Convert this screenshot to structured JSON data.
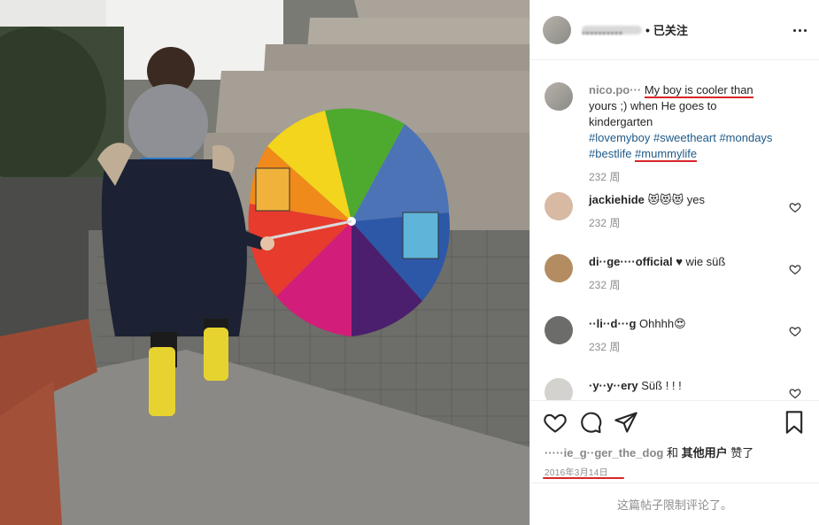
{
  "post": {
    "author_handle": "··········",
    "separator": "•",
    "follow_status": "已关注"
  },
  "caption": {
    "handle": "nico.po··· ",
    "text_part1": "My boy is cooler than",
    "text_part2": "yours ;) when He goes to kindergarten",
    "hashtags": [
      "#lovemyboy",
      "#sweetheart",
      "#mondays",
      "#bestlife",
      "#mummylife"
    ],
    "time": "232 周"
  },
  "comments": [
    {
      "handle": "jackiehide",
      "text": "😻😻😻 yes",
      "time": "232 周"
    },
    {
      "handle": "di··ge····official",
      "text": "♥ wie süß",
      "time": "232 周"
    },
    {
      "handle": "··li··d···g",
      "text": "Ohhhh😍",
      "time": "232 周"
    },
    {
      "handle": "·y··y··ery",
      "text": "Süß ! ! !",
      "time": ""
    }
  ],
  "likes": {
    "user": "·····ie_g··ger_the_dog",
    "and": "和",
    "others": "其他用户",
    "liked": "赞了"
  },
  "date": "2016年3月14日",
  "comments_disabled": "这篇帖子限制评论了。",
  "icons": [
    "like-icon",
    "comment-icon",
    "share-icon",
    "bookmark-icon",
    "more-icon"
  ]
}
